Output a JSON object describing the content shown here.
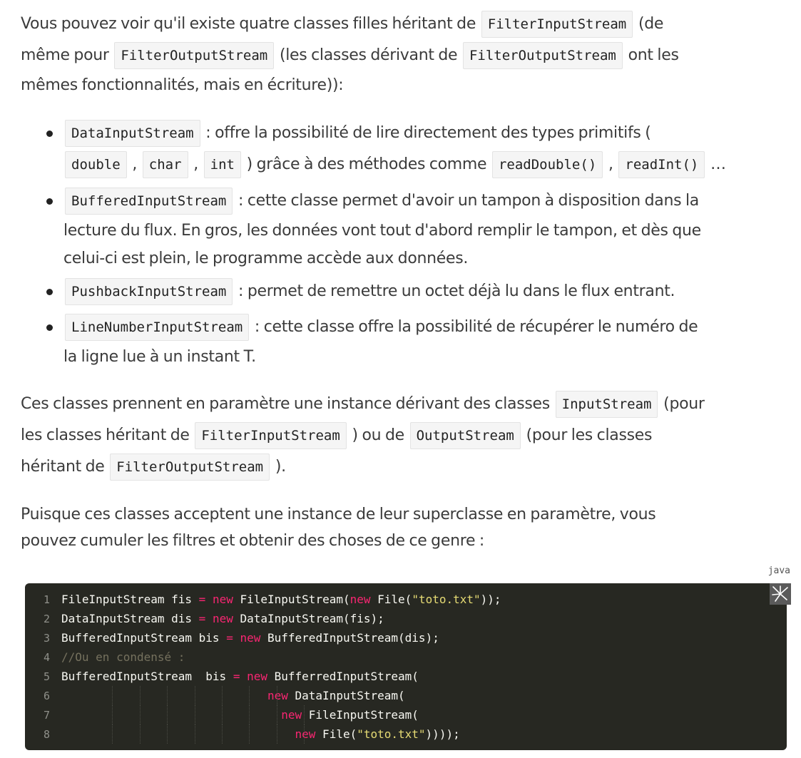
{
  "intro": {
    "l1_a": "Vous pouvez voir qu'il existe quatre classes filles héritant de",
    "l1_code": "FilterInputStream",
    "l1_b": "(de",
    "l2_a": "même pour",
    "l2_code1": "FilterOutputStream",
    "l2_b": "(les classes dérivant de",
    "l2_code2": "FilterOutputStream",
    "l2_c": "ont les",
    "l3": "mêmes fonctionnalités, mais en écriture)):"
  },
  "list": {
    "item1": {
      "code": "DataInputStream",
      "a": ": offre la possibilité de lire directement des types primitifs (",
      "c_double": "double",
      "sep1": ",",
      "c_char": "char",
      "sep2": ",",
      "c_int": "int",
      "b": ") grâce à des méthodes comme",
      "c_readDouble": "readDouble()",
      "sep3": ",",
      "c_readInt": "readInt()",
      "ellipsis": "…"
    },
    "item2": {
      "code": "BufferedInputStream",
      "a": ": cette classe permet d'avoir un tampon à disposition dans la",
      "l2": "lecture du flux. En gros, les données vont tout d'abord remplir le tampon, et dès que",
      "l3": "celui-ci est plein, le programme accède aux données."
    },
    "item3": {
      "code": "PushbackInputStream",
      "a": ": permet de remettre un octet déjà lu dans le flux entrant."
    },
    "item4": {
      "code": "LineNumberInputStream",
      "a": ": cette classe offre la possibilité de récupérer le numéro de",
      "l2": "la ligne lue à un instant T."
    }
  },
  "para2": {
    "l1_a": "Ces classes prennent en paramètre une instance dérivant des classes",
    "l1_code": "InputStream",
    "l1_b": "(pour",
    "l2_a": "les classes héritant de",
    "l2_code1": "FilterInputStream",
    "l2_b": ") ou de",
    "l2_code2": "OutputStream",
    "l2_c": "(pour les classes",
    "l3_a": "héritant de",
    "l3_code": "FilterOutputStream",
    "l3_b": ")."
  },
  "para3": {
    "l1": "Puisque ces classes acceptent une instance de leur superclasse en paramètre, vous",
    "l2": "pouvez cumuler les filtres et obtenir des choses de ce genre :"
  },
  "code_block": {
    "language": "java",
    "expand_icon": "expand-icon",
    "lines": [
      {
        "n": "1",
        "tokens": [
          [
            "plain",
            "FileInputStream fis "
          ],
          [
            "op",
            "="
          ],
          [
            "plain",
            " "
          ],
          [
            "kw",
            "new"
          ],
          [
            "plain",
            " FileInputStream("
          ],
          [
            "kw",
            "new"
          ],
          [
            "plain",
            " File("
          ],
          [
            "str",
            "\"toto.txt\""
          ],
          [
            "plain",
            "));"
          ]
        ]
      },
      {
        "n": "2",
        "tokens": [
          [
            "plain",
            "DataInputStream dis "
          ],
          [
            "op",
            "="
          ],
          [
            "plain",
            " "
          ],
          [
            "kw",
            "new"
          ],
          [
            "plain",
            " DataInputStream(fis);"
          ]
        ]
      },
      {
        "n": "3",
        "tokens": [
          [
            "plain",
            "BufferedInputStream bis "
          ],
          [
            "op",
            "="
          ],
          [
            "plain",
            " "
          ],
          [
            "kw",
            "new"
          ],
          [
            "plain",
            " BufferedInputStream(dis);"
          ]
        ]
      },
      {
        "n": "4",
        "tokens": [
          [
            "com",
            "//Ou en condensé :"
          ]
        ]
      },
      {
        "n": "5",
        "tokens": [
          [
            "plain",
            "BufferedInputStream  bis "
          ],
          [
            "op",
            "="
          ],
          [
            "plain",
            " "
          ],
          [
            "kw",
            "new"
          ],
          [
            "plain",
            " BufferredInputStream("
          ]
        ]
      },
      {
        "n": "6",
        "tokens": [
          [
            "plain",
            "                              "
          ],
          [
            "kw",
            "new"
          ],
          [
            "plain",
            " DataInputStream("
          ]
        ]
      },
      {
        "n": "7",
        "tokens": [
          [
            "plain",
            "                                "
          ],
          [
            "kw",
            "new"
          ],
          [
            "plain",
            " FileInputStream("
          ]
        ]
      },
      {
        "n": "8",
        "tokens": [
          [
            "plain",
            "                                  "
          ],
          [
            "kw",
            "new"
          ],
          [
            "plain",
            " File("
          ],
          [
            "str",
            "\"toto.txt\""
          ],
          [
            "plain",
            "))));"
          ]
        ]
      }
    ]
  },
  "colors": {
    "text": "#3b3b3b",
    "code_bg": "#272822",
    "keyword": "#f92672",
    "string": "#e6db74",
    "comment": "#75715e"
  }
}
